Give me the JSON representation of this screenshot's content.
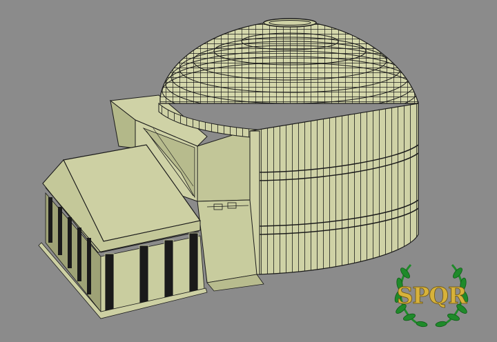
{
  "scene": {
    "background_color": "#8b8b8b",
    "model_color": "#cfd2a6",
    "shadow_color": "#aeb387",
    "wire_color": "#1a1a1a"
  },
  "emblem": {
    "text": "SPQR",
    "text_color": "#d7b23a",
    "laurel_color": "#1f8a2a",
    "icon": "laurel-wreath-icon"
  }
}
